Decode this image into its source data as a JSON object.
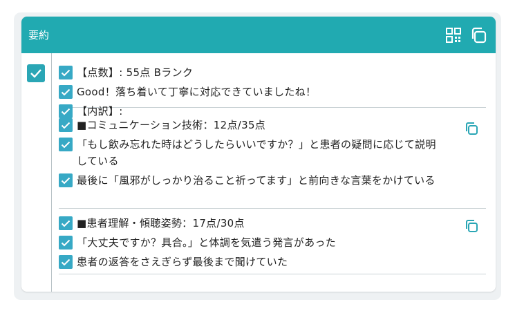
{
  "header": {
    "title": "要約",
    "qr_icon": "qr-code-icon",
    "copy_icon": "copy-icon"
  },
  "colors": {
    "accent": "#21aab1",
    "checkbox": "#37a9c5",
    "copy_icon": "#2aa6b5"
  },
  "sections": [
    {
      "items": [
        "【点数】: 55点 Bランク",
        "Good！落ち着いて丁寧に対応できていましたね！",
        "【内訳】:"
      ]
    },
    {
      "items": [
        "■コミュニケーション技術：12点/35点",
        "「もし飲み忘れた時はどうしたらいいですか？」と患者の疑問に応じて説明している",
        "最後に「風邪がしっかり治ること祈ってます」と前向きな言葉をかけている"
      ]
    },
    {
      "items": [
        "■患者理解・傾聴姿勢：17点/30点",
        "「大丈夫ですか？具合。」と体調を気遣う発言があった",
        "患者の返答をさえぎらず最後まで聞けていた"
      ]
    }
  ]
}
